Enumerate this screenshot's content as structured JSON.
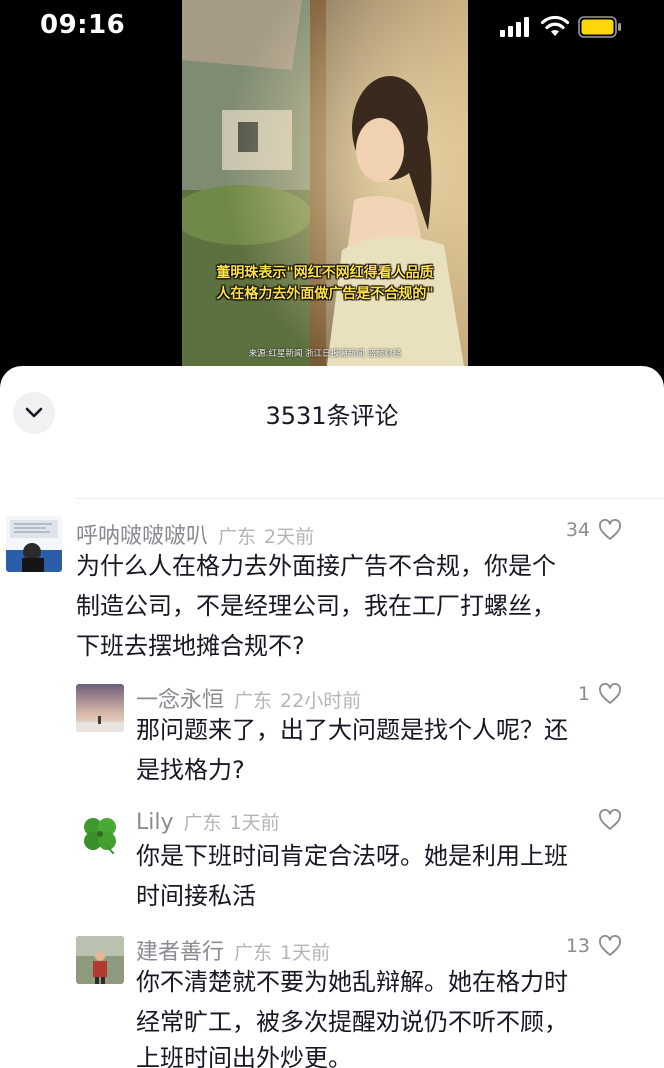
{
  "status_bar": {
    "time": "09:16"
  },
  "video": {
    "caption_line1": "董明珠表示\"网红不网红得看人品质",
    "caption_line2": "人在格力去外面做广告是不合规的\"",
    "source": "来源:红星新闻 浙江日报潮新闻 蓝鲸财经"
  },
  "comments_panel": {
    "title": "3531条评论",
    "comments": [
      {
        "username": "呼呐啵啵啵叭",
        "location": "广东",
        "time": "2天前",
        "likes": "34",
        "line1": "为什么人在格力去外面接广告不合规，你是个",
        "line2": "制造公司，不是经理公司，我在工厂打螺丝，",
        "line3": "下班去摆地摊合规不?",
        "avatar_icon": "user-photo-avatar"
      },
      {
        "username": "一念永恒",
        "location": "广东",
        "time": "22小时前",
        "likes": "1",
        "line1": "那问题来了，出了大问题是找个人呢？还",
        "line2": "是找格力?",
        "avatar_icon": "landscape-avatar"
      },
      {
        "username": "Lily",
        "location": "广东",
        "time": "1天前",
        "likes": "",
        "line1": "你是下班时间肯定合法呀。她是利用上班",
        "line2": "时间接私活",
        "avatar_icon": "clover-avatar"
      },
      {
        "username": "建者善行",
        "location": "广东",
        "time": "1天前",
        "likes": "13",
        "line1": "你不清楚就不要为她乱辩解。她在格力时",
        "line2": "经常旷工，被多次提醒劝说仍不听不顾，",
        "line3": "上班时间出外炒更。",
        "avatar_icon": "person-photo-avatar"
      }
    ]
  },
  "colors": {
    "caption_yellow": "#ffe14a",
    "battery_yellow": "#ffd60a",
    "text_primary": "#161823",
    "text_secondary": "#8a8b91"
  }
}
